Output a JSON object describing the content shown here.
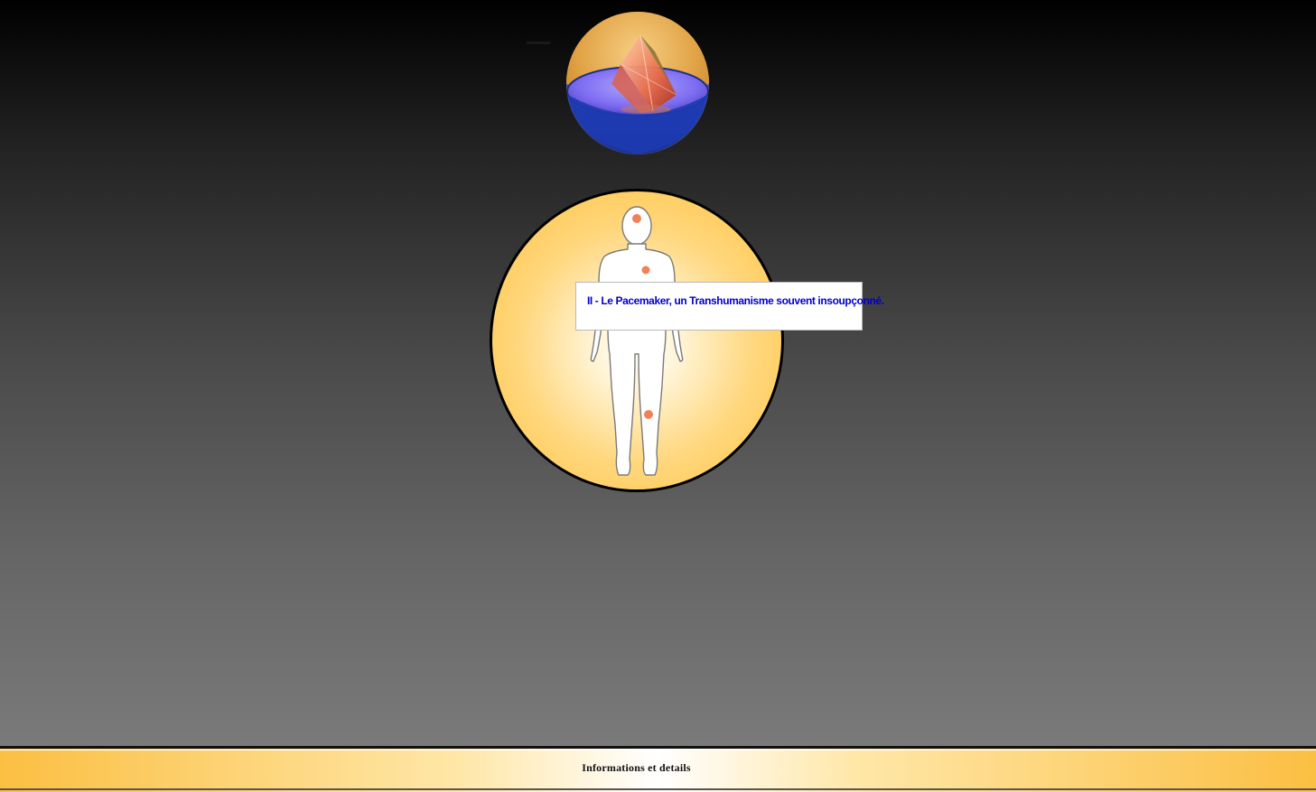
{
  "logo": {
    "icon": "prism-in-bowl-icon",
    "colors": {
      "bowl_outer": "#1f3fb0",
      "bowl_inner": "#8b7cff",
      "prism": "#e0503a",
      "background": "#e4a54a"
    }
  },
  "body_map": {
    "icon": "human-body-silhouette-icon",
    "marker_color": "#ee6c3a",
    "marker_count": 3
  },
  "popup": {
    "title": "II - Le Pacemaker, un Transhumanisme souvent insoupçonné.",
    "title_color": "#0000cc"
  },
  "footer": {
    "link_label": "Informations et details"
  }
}
